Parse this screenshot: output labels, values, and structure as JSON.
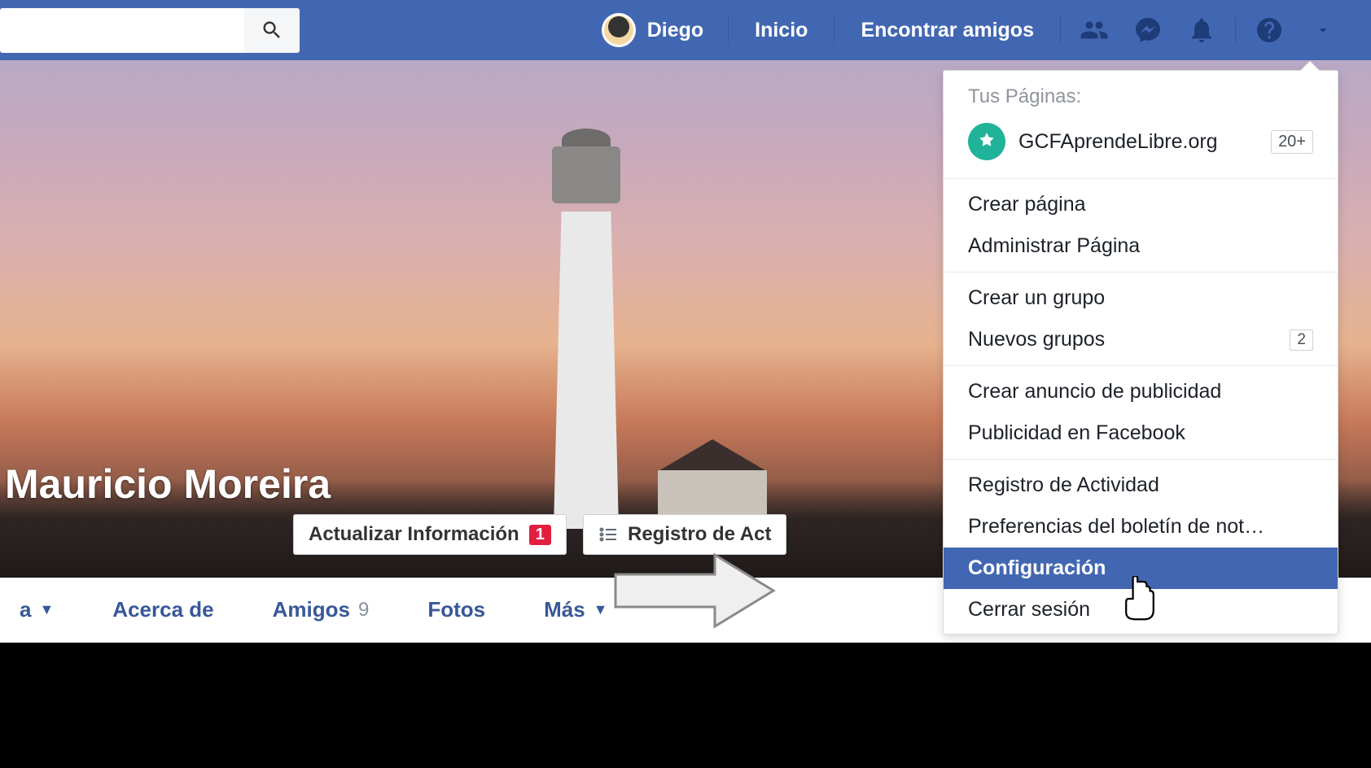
{
  "topnav": {
    "user_name": "Diego",
    "home": "Inicio",
    "find_friends": "Encontrar amigos",
    "search_placeholder": ""
  },
  "profile": {
    "name": "Mauricio Moreira",
    "update_info_btn": "Actualizar Información",
    "update_info_badge": "1",
    "activity_log_btn": "Registro de Act"
  },
  "tabs": {
    "timeline_partial": "a",
    "about": "Acerca de",
    "friends": "Amigos",
    "friends_count": "9",
    "photos": "Fotos",
    "more": "Más"
  },
  "dropdown": {
    "pages_header": "Tus Páginas:",
    "page_name": "GCFAprendeLibre.org",
    "page_badge": "20+",
    "create_page": "Crear página",
    "manage_page": "Administrar Página",
    "create_group": "Crear un grupo",
    "new_groups": "Nuevos grupos",
    "new_groups_badge": "2",
    "create_ad": "Crear anuncio de publicidad",
    "advertising": "Publicidad en Facebook",
    "activity_log": "Registro de Actividad",
    "news_prefs": "Preferencias del boletín de not…",
    "settings": "Configuración",
    "logout": "Cerrar sesión"
  }
}
